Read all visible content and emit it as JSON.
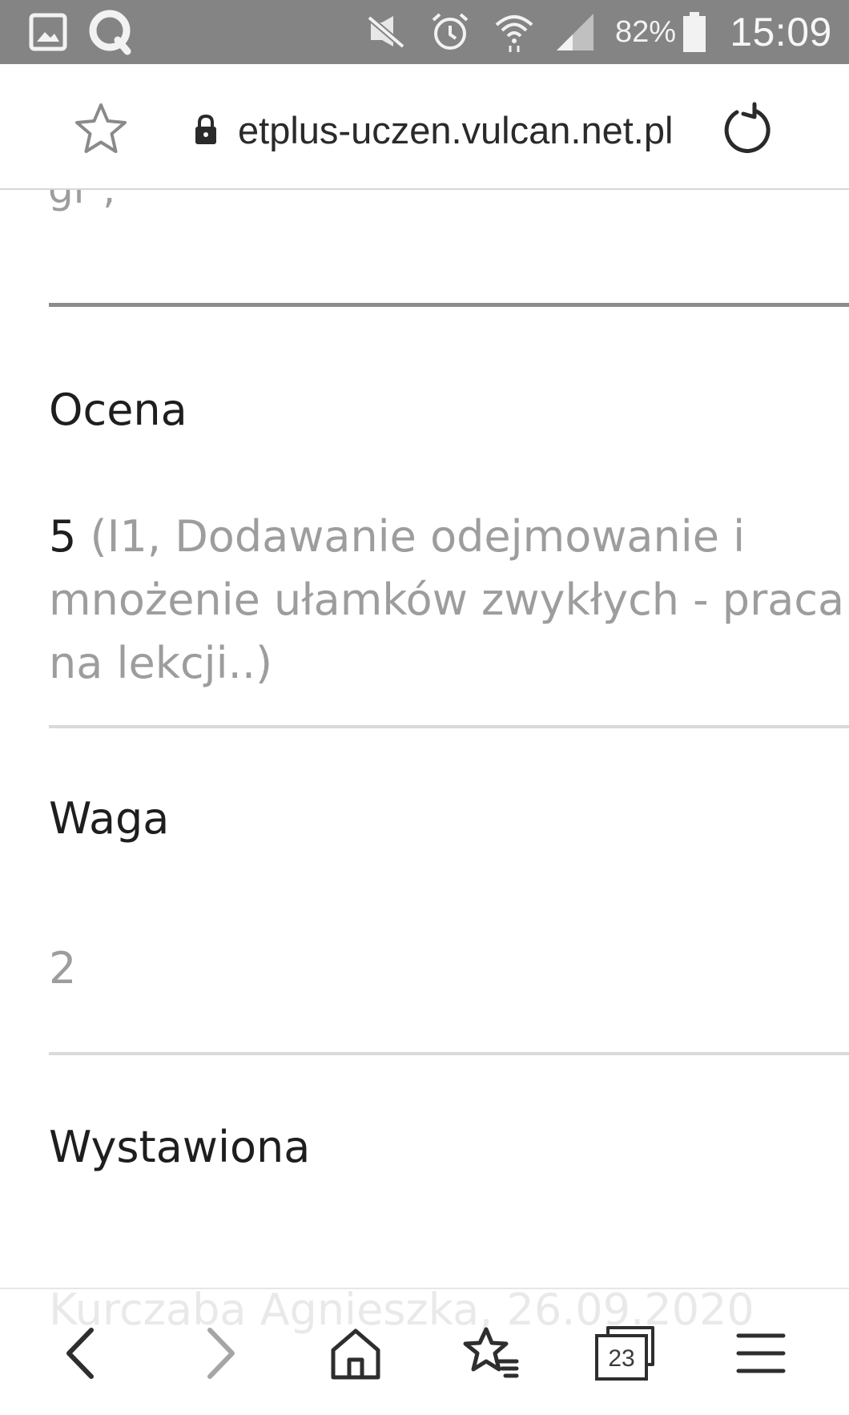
{
  "status_bar": {
    "icons": [
      "gallery-notification-icon",
      "quick-search-notification-icon",
      "mute-icon",
      "alarm-icon",
      "wifi-icon",
      "signal-icon",
      "battery-icon"
    ],
    "battery_percent": "82%",
    "clock": "15:09"
  },
  "address_bar": {
    "url": "etplus-uczen.vulcan.net.pl"
  },
  "content": {
    "cut_off_top_text": "gr ,",
    "fields": [
      {
        "label": "Ocena",
        "value_main": "5",
        "value_detail_line1": "(I1, Dodawanie odejmowanie i",
        "value_detail_line2": "mnożenie ułamków zwykłych - praca",
        "value_detail_line3": "na lekcji..)"
      },
      {
        "label": "Waga",
        "value": "2"
      },
      {
        "label": "Wystawiona",
        "value": "Kurczaba Agnieszka, 26.09.2020"
      }
    ]
  },
  "toolbar": {
    "buttons": [
      "back",
      "forward",
      "home",
      "bookmarks",
      "tabs",
      "menu"
    ],
    "tabs_count": "23"
  },
  "colors": {
    "status_bar_bg": "#848484",
    "label_text": "#1e1e1e",
    "muted_text": "#9d9d9d",
    "divider": "#dadada"
  }
}
